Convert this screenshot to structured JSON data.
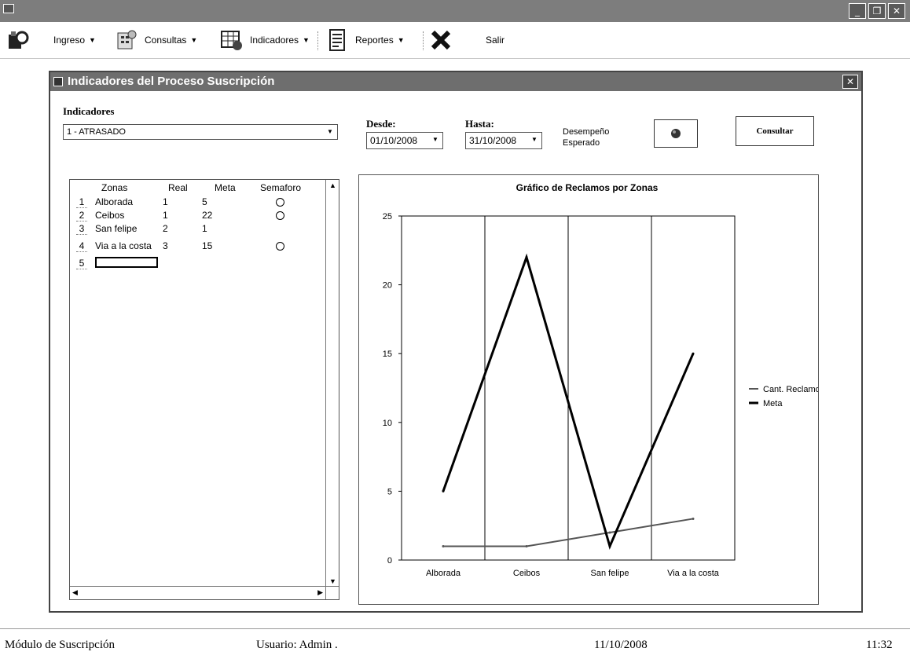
{
  "menubar": {
    "items": [
      {
        "label": "Ingreso",
        "icon": "ingreso-icon",
        "has_dropdown": true
      },
      {
        "label": "Consultas",
        "icon": "consultas-icon",
        "has_dropdown": true
      },
      {
        "label": "Indicadores",
        "icon": "indicadores-icon",
        "has_dropdown": true
      },
      {
        "label": "Reportes",
        "icon": "reportes-icon",
        "has_dropdown": true
      },
      {
        "label": "Salir",
        "icon": "close-x-icon",
        "has_dropdown": false
      }
    ]
  },
  "window": {
    "title": "Indicadores del Proceso Suscripción"
  },
  "form": {
    "indicadores_label": "Indicadores",
    "indicador_value": "1 - ATRASADO",
    "desde_label": "Desde:",
    "desde_value": "01/10/2008",
    "hasta_label": "Hasta:",
    "hasta_value": "31/10/2008",
    "desempeno_label_1": "Desempeño",
    "desempeno_label_2": "Esperado",
    "consultar_label": "Consultar"
  },
  "grid": {
    "headers": [
      "Zonas",
      "Real",
      "Meta",
      "Semaforo"
    ],
    "rows": [
      {
        "num": "1",
        "zona": "Alborada",
        "real": "1",
        "meta": "5",
        "semaforo": true
      },
      {
        "num": "2",
        "zona": "Ceibos",
        "real": "1",
        "meta": "22",
        "semaforo": true
      },
      {
        "num": "3",
        "zona": "San felipe",
        "real": "2",
        "meta": "1",
        "semaforo": false
      },
      {
        "num": "4",
        "zona": "Via a la costa",
        "real": "3",
        "meta": "15",
        "semaforo": true
      },
      {
        "num": "5",
        "zona": "",
        "real": "",
        "meta": "",
        "semaforo": false
      }
    ]
  },
  "chart_data": {
    "type": "line",
    "title": "Gráfico de Reclamos por Zonas",
    "categories": [
      "Alborada",
      "Ceibos",
      "San felipe",
      "Via a la costa"
    ],
    "series": [
      {
        "name": "Cant. Reclamos",
        "values": [
          1,
          1,
          2,
          3
        ]
      },
      {
        "name": "Meta",
        "values": [
          5,
          22,
          1,
          15
        ]
      }
    ],
    "ylim": [
      0,
      25
    ],
    "yticks": [
      0,
      5,
      10,
      15,
      20,
      25
    ],
    "legend": "right",
    "grid": "vertical"
  },
  "status": {
    "module": "Módulo de Suscripción",
    "user": "Usuario: Admin .",
    "date": "11/10/2008",
    "time": "11:32"
  }
}
